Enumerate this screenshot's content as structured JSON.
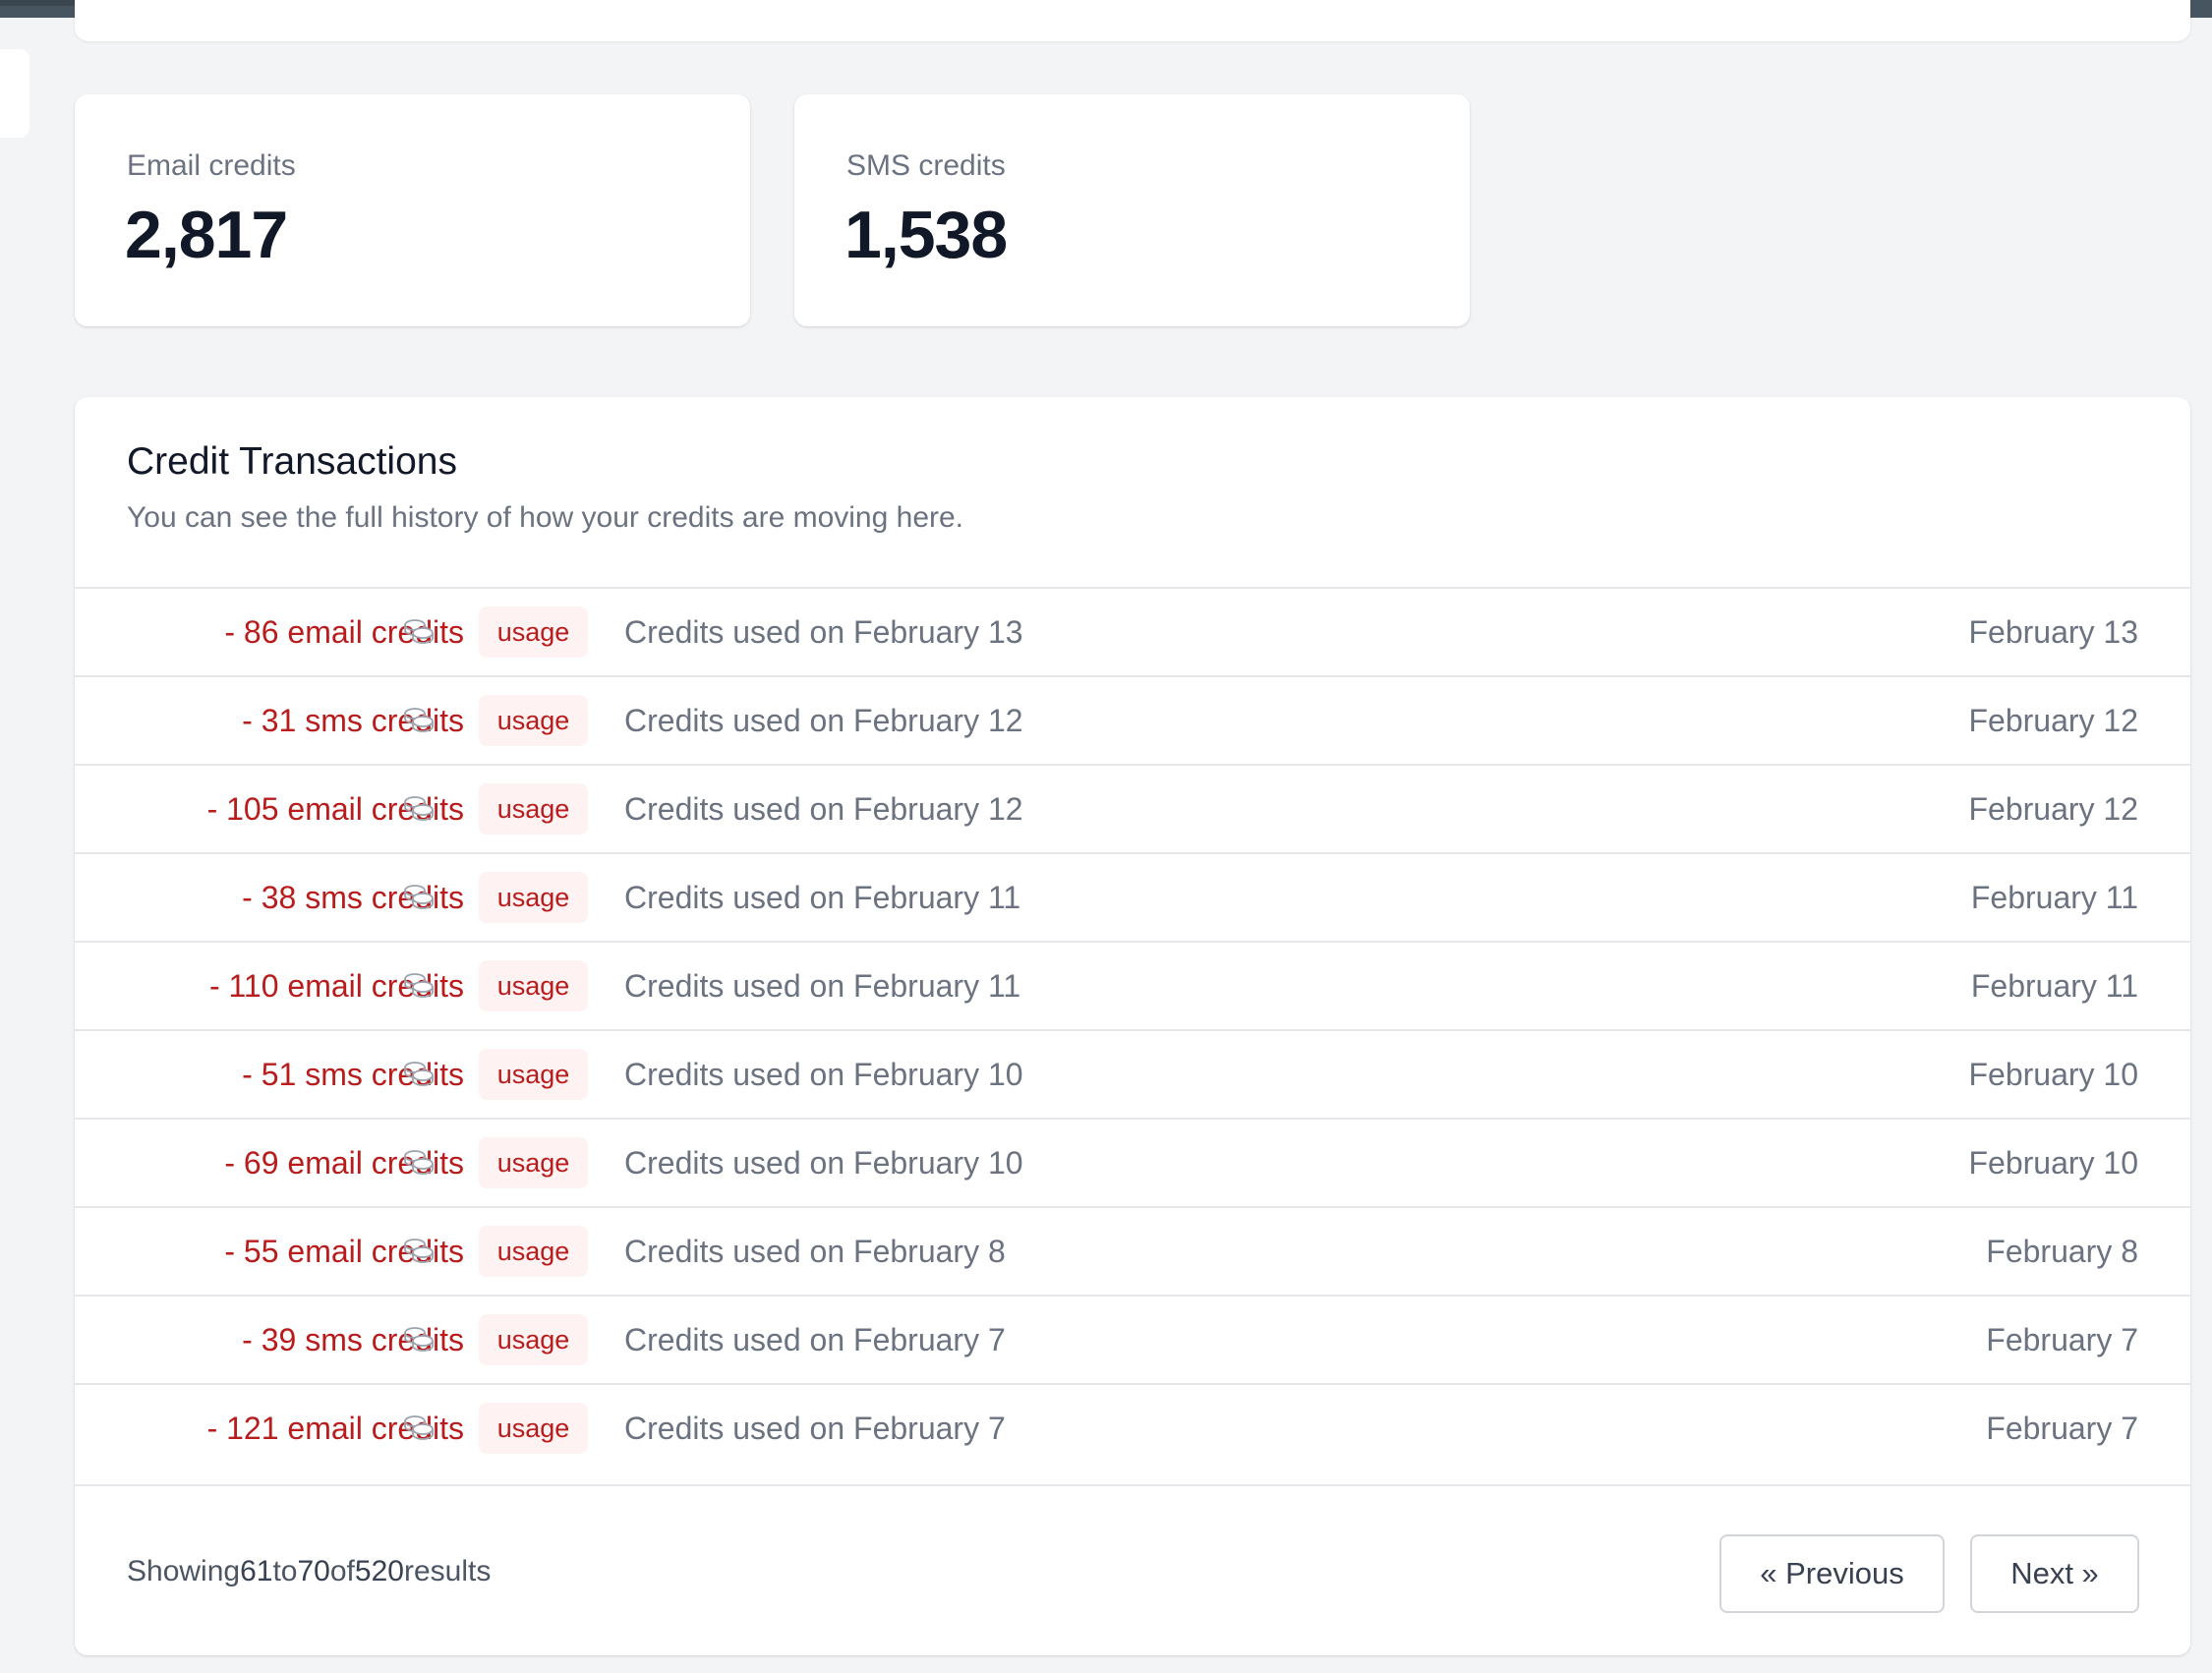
{
  "stats": {
    "email": {
      "label": "Email credits",
      "value": "2,817"
    },
    "sms": {
      "label": "SMS credits",
      "value": "1,538"
    }
  },
  "transactions": {
    "title": "Credit Transactions",
    "subtitle": "You can see the full history of how your credits are moving here.",
    "rows": [
      {
        "amount": "- 86 email credits",
        "type": "usage",
        "description": "Credits used on February 13",
        "date": "February 13",
        "icon": "coins-icon"
      },
      {
        "amount": "- 31 sms credits",
        "type": "usage",
        "description": "Credits used on February 12",
        "date": "February 12",
        "icon": "coins-icon"
      },
      {
        "amount": "- 105 email credits",
        "type": "usage",
        "description": "Credits used on February 12",
        "date": "February 12",
        "icon": "coins-icon"
      },
      {
        "amount": "- 38 sms credits",
        "type": "usage",
        "description": "Credits used on February 11",
        "date": "February 11",
        "icon": "coins-icon"
      },
      {
        "amount": "- 110 email credits",
        "type": "usage",
        "description": "Credits used on February 11",
        "date": "February 11",
        "icon": "coins-icon"
      },
      {
        "amount": "- 51 sms credits",
        "type": "usage",
        "description": "Credits used on February 10",
        "date": "February 10",
        "icon": "coins-icon"
      },
      {
        "amount": "- 69 email credits",
        "type": "usage",
        "description": "Credits used on February 10",
        "date": "February 10",
        "icon": "coins-icon"
      },
      {
        "amount": "- 55 email credits",
        "type": "usage",
        "description": "Credits used on February 8",
        "date": "February 8",
        "icon": "coins-icon"
      },
      {
        "amount": "- 39 sms credits",
        "type": "usage",
        "description": "Credits used on February 7",
        "date": "February 7",
        "icon": "coins-icon"
      },
      {
        "amount": "- 121 email credits",
        "type": "usage",
        "description": "Credits used on February 7",
        "date": "February 7",
        "icon": "coins-icon"
      }
    ]
  },
  "pagination": {
    "showing_label": "Showing",
    "from": "61",
    "to_label": "to",
    "to": "70",
    "of_label": "of",
    "total": "520",
    "results_label": "results",
    "previous_label": "« Previous",
    "next_label": "Next »"
  },
  "colors": {
    "negative_amount": "#b91c1c",
    "badge_bg": "#fef2f2",
    "page_bg": "#f3f4f6",
    "topbar": "#475560"
  }
}
